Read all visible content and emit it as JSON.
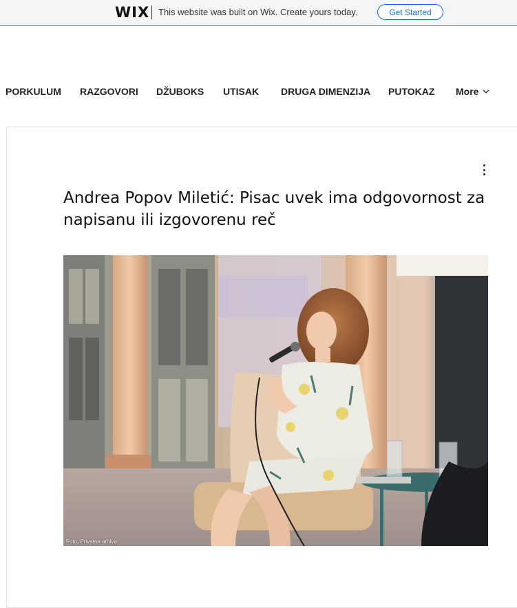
{
  "wix_banner": {
    "logo": "WIX",
    "message": "This website was built on Wix. Create yours today.",
    "cta_label": "Get Started"
  },
  "nav": {
    "items": [
      {
        "label": "PORKULUM"
      },
      {
        "label": "RAZGOVORI"
      },
      {
        "label": "DŽUBOKS"
      },
      {
        "label": "UTISAK"
      },
      {
        "label": "DRUGA DIMENZIJA"
      },
      {
        "label": "PUTOKAZ"
      }
    ],
    "more_label": "More"
  },
  "post": {
    "title": "Andrea Popov Miletić: Pisac uvek ima odgovornost za napisanu ili izgovorenu reč",
    "photo_caption": "Foto: Privatna arhiva",
    "menu_icon": "more-vertical-icon"
  },
  "colors": {
    "accent": "#116dff",
    "banner_bg": "#f4f5f7",
    "text": "#222222"
  }
}
